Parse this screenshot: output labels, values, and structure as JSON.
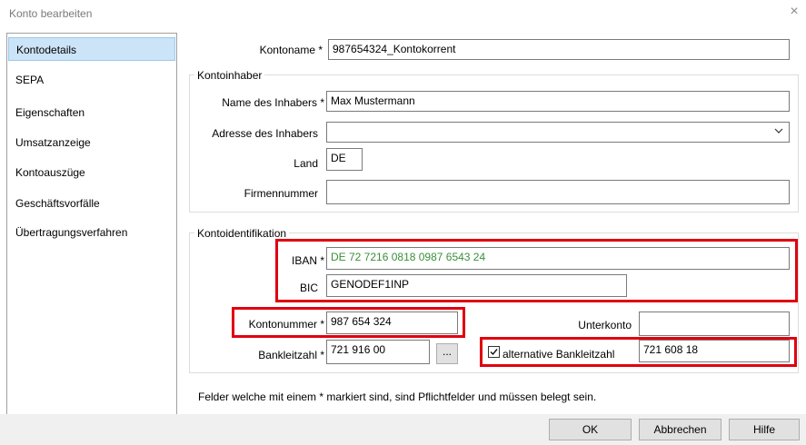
{
  "window": {
    "title": "Konto bearbeiten",
    "close_glyph": "×"
  },
  "nav": {
    "items": [
      {
        "label": "Kontodetails",
        "selected": true
      },
      {
        "label": "SEPA"
      },
      {
        "label": "Eigenschaften"
      },
      {
        "label": "Umsatzanzeige"
      },
      {
        "label": "Kontoauszüge"
      },
      {
        "label": "Geschäftsvorfälle"
      },
      {
        "label": "Übertragungsverfahren"
      }
    ]
  },
  "form": {
    "kontoname": {
      "label": "Kontoname *",
      "value": "987654324_Kontokorrent"
    },
    "kontoinhaber": {
      "title": "Kontoinhaber",
      "name": {
        "label": "Name des Inhabers *",
        "value": "Max Mustermann"
      },
      "adresse": {
        "label": "Adresse des Inhabers",
        "value": ""
      },
      "land": {
        "label": "Land",
        "value": "DE"
      },
      "firmennummer": {
        "label": "Firmennummer",
        "value": ""
      }
    },
    "kontoidentifikation": {
      "title": "Kontoidentifikation",
      "iban": {
        "label": "IBAN *",
        "value": "DE 72 7216 0818 0987 6543 24",
        "color": "#3a8f3a"
      },
      "bic": {
        "label": "BIC",
        "value": "GENODEF1INP"
      }
    },
    "kontonummer": {
      "label": "Kontonummer *",
      "value": "987 654 324"
    },
    "unterkonto": {
      "label": "Unterkonto",
      "value": ""
    },
    "bankleitzahl": {
      "label": "Bankleitzahl *",
      "value": "721 916 00",
      "browse_label": "..."
    },
    "alt_blz": {
      "label": "alternative Bankleitzahl",
      "checked": true,
      "value": "721 608 18"
    },
    "note": "Felder welche mit einem * markiert sind, sind Pflichtfelder und müssen belegt sein."
  },
  "buttons": {
    "ok": "OK",
    "cancel": "Abbrechen",
    "help": "Hilfe"
  },
  "colors": {
    "highlight": "#e0000f",
    "selection": "#cce4f7"
  }
}
